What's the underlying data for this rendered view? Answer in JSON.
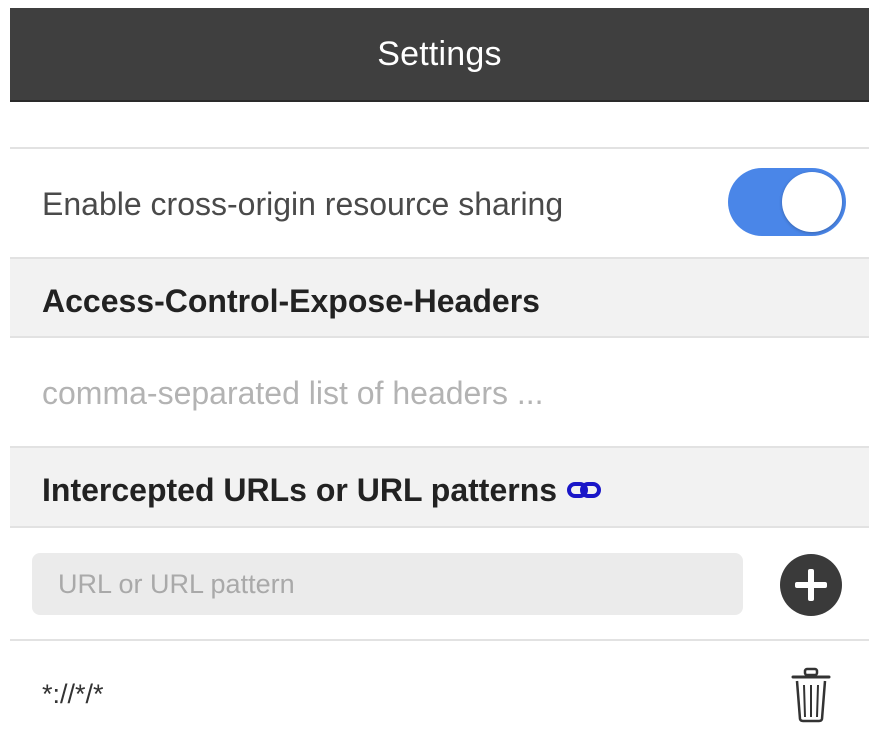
{
  "header": {
    "title": "Settings"
  },
  "cors": {
    "label": "Enable cross-origin resource sharing",
    "enabled": true,
    "toggle_color": "#4a86e8"
  },
  "expose_headers": {
    "title": "Access-Control-Expose-Headers",
    "placeholder": "comma-separated list of headers ...",
    "value": ""
  },
  "intercepted": {
    "title": "Intercepted URLs or URL patterns",
    "link_icon": "link-icon",
    "link_color": "#1a16c8",
    "input_placeholder": "URL or URL pattern",
    "input_value": "",
    "add_icon": "plus-circle-icon",
    "patterns": [
      {
        "pattern": "*://*/*",
        "delete_icon": "trash-icon"
      }
    ]
  }
}
